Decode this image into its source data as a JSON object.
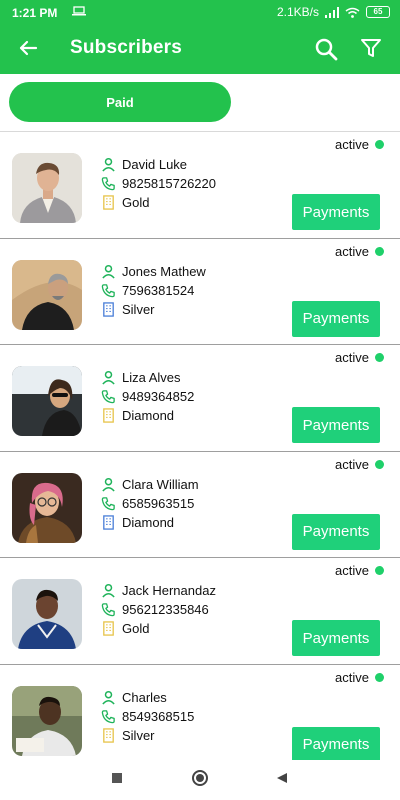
{
  "statusbar": {
    "time": "1:21 PM",
    "right_text": "2.1KB/s",
    "battery": "65",
    "icons": [
      "laptop-icon",
      "wifi-icon",
      "signal-icon",
      "battery-icon"
    ]
  },
  "appbar": {
    "title": "Subscribers",
    "color": "#23c24d",
    "icons": {
      "back": "arrow-left-icon",
      "search": "search-icon",
      "filter": "filter-icon"
    }
  },
  "filter_chip": {
    "label": "Paid"
  },
  "subscribers": [
    {
      "name": "David Luke",
      "phone": "9825815726220",
      "plan": "Gold",
      "status": "active",
      "action": "Payments"
    },
    {
      "name": "Jones Mathew",
      "phone": "7596381524",
      "plan": "Silver",
      "status": "active",
      "action": "Payments"
    },
    {
      "name": "Liza Alves",
      "phone": "9489364852",
      "plan": "Diamond",
      "status": "active",
      "action": "Payments"
    },
    {
      "name": "Clara William",
      "phone": "6585963515",
      "plan": "Diamond",
      "status": "active",
      "action": "Payments"
    },
    {
      "name": "Jack Hernandaz",
      "phone": "956212335846",
      "plan": "Gold",
      "status": "active",
      "action": "Payments"
    },
    {
      "name": "Charles",
      "phone": "8549368515",
      "plan": "Silver",
      "status": "active",
      "action": "Payments"
    }
  ],
  "nav": {
    "icons": [
      "recents-square-icon",
      "home-circle-icon",
      "back-triangle-icon"
    ]
  }
}
